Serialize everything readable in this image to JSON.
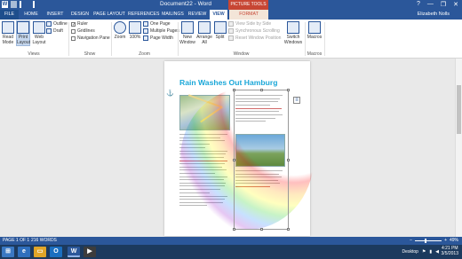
{
  "window": {
    "doc_title": "Document22 - Word",
    "picture_tools_label": "PICTURE TOOLS",
    "help": "?",
    "min": "—",
    "restore": "❐",
    "close": "✕",
    "word_logo": "W"
  },
  "tabs": [
    "FILE",
    "HOME",
    "INSERT",
    "DESIGN",
    "PAGE LAYOUT",
    "REFERENCES",
    "MAILINGS",
    "REVIEW",
    "VIEW",
    "FORMAT"
  ],
  "active_tab": "VIEW",
  "user_name": "Elizabeth Nolls",
  "ribbon": {
    "views": {
      "read_mode": "Read Mode",
      "print_layout": "Print Layout",
      "web_layout": "Web Layout",
      "outline": "Outline",
      "draft": "Draft",
      "group_label": "Views"
    },
    "show": {
      "ruler": "Ruler",
      "gridlines": "Gridlines",
      "navigation_pane": "Navigation Pane",
      "ruler_checked": "✓",
      "group_label": "Show"
    },
    "zoom": {
      "zoom": "Zoom",
      "hundred": "100%",
      "one_page": "One Page",
      "multiple_pages": "Multiple Pages",
      "page_width": "Page Width",
      "group_label": "Zoom"
    },
    "window": {
      "new_window": "New Window",
      "arrange_all": "Arrange All",
      "split": "Split",
      "view_side_by_side": "View Side by Side",
      "sync_scrolling": "Synchronous Scrolling",
      "reset_window": "Reset Window Position",
      "switch_windows": "Switch Windows",
      "group_label": "Window"
    },
    "macros": {
      "macros": "Macros",
      "group_label": "Macros"
    }
  },
  "document": {
    "heading": "Rain Washes Out Hamburg",
    "layout_options_icon": "≡",
    "anchor_icon": "⚓"
  },
  "status": {
    "page": "PAGE 1 OF 1",
    "words": "216 WORDS",
    "zoom_level": "49%",
    "zoom_minus": "−",
    "zoom_plus": "+"
  },
  "taskbar": {
    "desktop_label": "Desktop",
    "time": "4:21 PM",
    "date": "3/5/2013"
  },
  "colors": {
    "word_blue": "#2b579a",
    "picture_tools_red": "#c74634",
    "heading_blue": "#1aa7d8"
  }
}
